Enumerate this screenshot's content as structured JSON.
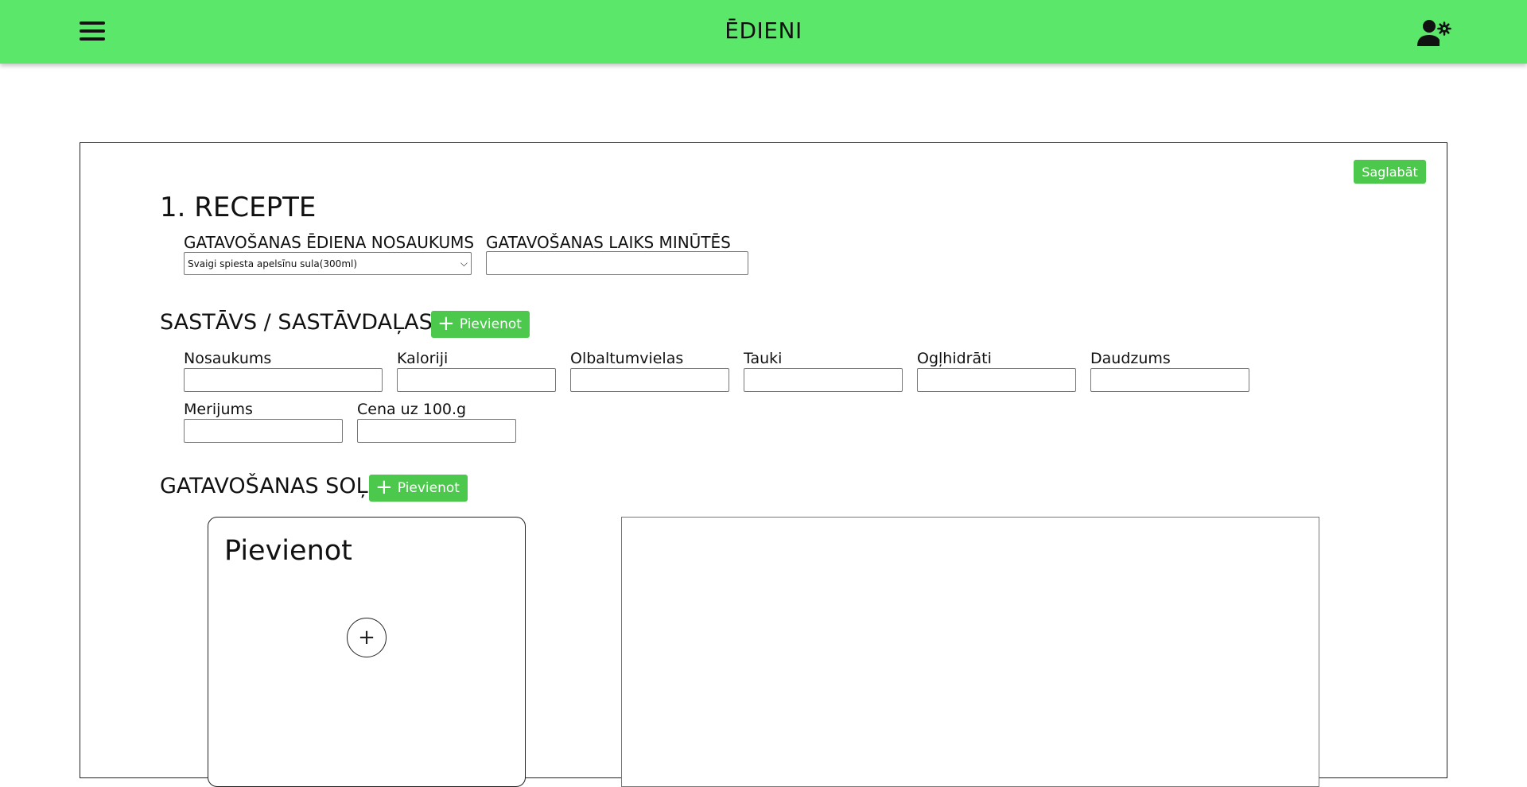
{
  "header": {
    "title": "ĒDIENI",
    "menu_icon": "hamburger-menu-icon",
    "user_icon": "user-settings-icon",
    "bg_color": "#5be86a"
  },
  "save_label": "Saglabāt",
  "recipe": {
    "heading": "1. RECEPTE",
    "name_label": "GATAVOŠANAS ĒDIENA NOSAUKUMS",
    "name_value": "Svaigi spiesta apelsīnu sula(300ml)",
    "time_label": "GATAVOŠANAS LAIKS MINŪTĒS",
    "time_value": ""
  },
  "ingredients": {
    "heading": "SASTĀVS / SASTĀVDAĻAS",
    "add_label": "Pievienot",
    "fields": [
      {
        "label": "Nosaukums",
        "value": ""
      },
      {
        "label": "Kaloriji",
        "value": ""
      },
      {
        "label": "Olbaltumvielas",
        "value": ""
      },
      {
        "label": "Tauki",
        "value": ""
      },
      {
        "label": "Ogļhidrāti",
        "value": ""
      },
      {
        "label": "Daudzums",
        "value": ""
      },
      {
        "label": "Merijums",
        "value": ""
      },
      {
        "label": "Cena uz 100.g",
        "value": ""
      }
    ]
  },
  "steps": {
    "heading": "GATAVOŠANAS SOĻI",
    "add_label": "Pievienot",
    "card_title": "Pievienot",
    "card_icon": "plus-circle-icon"
  },
  "accent_color": "#4cc94c"
}
